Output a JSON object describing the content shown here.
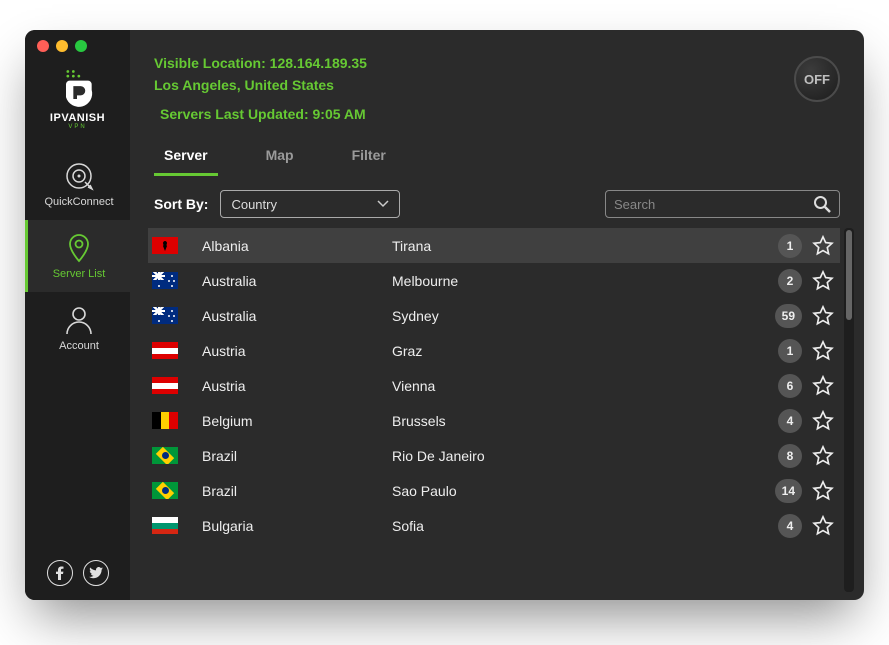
{
  "brand": {
    "name": "IPVANISH",
    "sub": "VPN"
  },
  "traffic": {
    "close": "#ff5f57",
    "min": "#febc2e",
    "max": "#28c840"
  },
  "header": {
    "location_label": "Visible Location:",
    "ip": "128.164.189.35",
    "city_country": "Los Angeles, United States",
    "servers_updated_label": "Servers Last Updated:",
    "servers_updated_time": "9:05 AM",
    "off_label": "OFF"
  },
  "nav": [
    {
      "id": "quickconnect",
      "label": "QuickConnect",
      "active": false
    },
    {
      "id": "serverlist",
      "label": "Server List",
      "active": true
    },
    {
      "id": "account",
      "label": "Account",
      "active": false
    }
  ],
  "tabs": [
    {
      "label": "Server",
      "active": true
    },
    {
      "label": "Map",
      "active": false
    },
    {
      "label": "Filter",
      "active": false
    }
  ],
  "sort": {
    "label": "Sort By:",
    "value": "Country"
  },
  "search": {
    "placeholder": "Search",
    "value": ""
  },
  "servers": [
    {
      "flag": "albania",
      "country": "Albania",
      "city": "Tirana",
      "count": 1,
      "selected": true
    },
    {
      "flag": "australia",
      "country": "Australia",
      "city": "Melbourne",
      "count": 2,
      "selected": false
    },
    {
      "flag": "australia",
      "country": "Australia",
      "city": "Sydney",
      "count": 59,
      "selected": false
    },
    {
      "flag": "austria",
      "country": "Austria",
      "city": "Graz",
      "count": 1,
      "selected": false
    },
    {
      "flag": "austria",
      "country": "Austria",
      "city": "Vienna",
      "count": 6,
      "selected": false
    },
    {
      "flag": "belgium",
      "country": "Belgium",
      "city": "Brussels",
      "count": 4,
      "selected": false
    },
    {
      "flag": "brazil",
      "country": "Brazil",
      "city": "Rio De Janeiro",
      "count": 8,
      "selected": false
    },
    {
      "flag": "brazil",
      "country": "Brazil",
      "city": "Sao Paulo",
      "count": 14,
      "selected": false
    },
    {
      "flag": "bulgaria",
      "country": "Bulgaria",
      "city": "Sofia",
      "count": 4,
      "selected": false
    }
  ],
  "colors": {
    "accent": "#66c933"
  }
}
